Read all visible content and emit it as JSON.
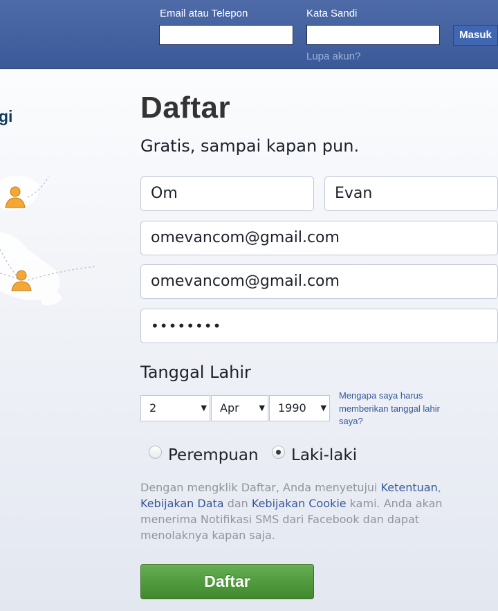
{
  "header": {
    "email_label": "Email atau Telepon",
    "password_label": "Kata Sandi",
    "login_button": "Masuk",
    "forgot_link": "Lupa akun?"
  },
  "left": {
    "partial_text": "gi"
  },
  "signup": {
    "title": "Daftar",
    "subtitle": "Gratis, sampai kapan pun.",
    "first_name": "Om",
    "last_name": "Evan",
    "email": "omevancom@gmail.com",
    "email_confirm": "omevancom@gmail.com",
    "password_mask": "••••••••",
    "dob_label": "Tanggal Lahir",
    "dob_day": "2",
    "dob_month": "Apr",
    "dob_year": "1990",
    "dob_why": "Mengapa saya harus memberikan tanggal lahir saya?",
    "gender_female": "Perempuan",
    "gender_male": "Laki-laki",
    "gender_selected": "Laki-laki",
    "terms": {
      "p1": "Dengan mengklik Daftar, Anda menyetujui ",
      "link_terms": "Ketentuan",
      "p2": ", ",
      "link_data": "Kebijakan Data",
      "p3": " dan ",
      "link_cookie": "Kebijakan Cookie",
      "p4": " kami. Anda akan menerima Notifikasi SMS dari Facebook dan dapat menolaknya kapan saja."
    },
    "submit_button": "Daftar"
  },
  "icons": {
    "caret": "▼",
    "person": "person-icon"
  },
  "colors": {
    "header_blue": "#3b5998",
    "link_blue": "#365899",
    "signup_green": "#4f9a3c"
  }
}
